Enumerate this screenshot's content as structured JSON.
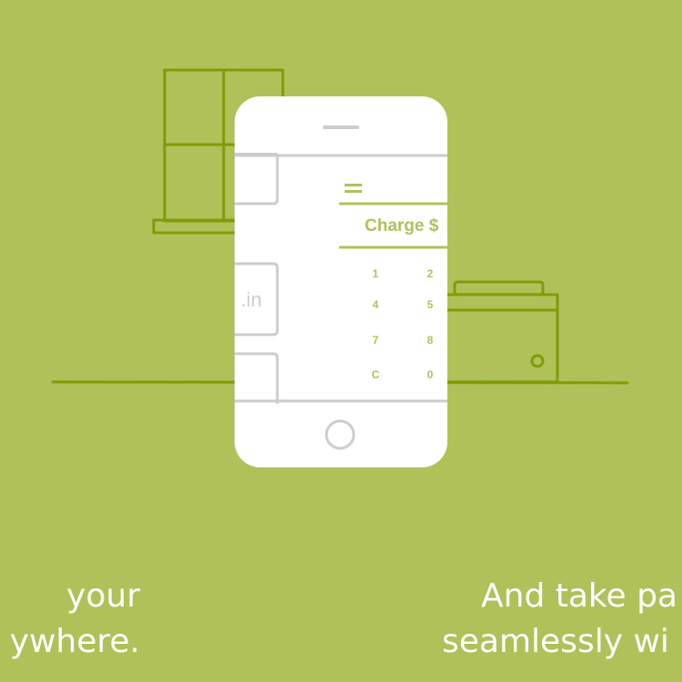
{
  "colors": {
    "background": "#b0c15a",
    "line_art": "#7e9c06",
    "phone_body": "#ffffff",
    "phone_outline": "#cccccc",
    "app_accent": "#b0c15a",
    "caption_text": "#ffffff"
  },
  "phone": {
    "app": {
      "menu_icon": "hamburger-menu-icon",
      "charge_label": "Charge $",
      "keypad_keys": [
        "1",
        "2",
        "4",
        "5",
        "7",
        "8",
        "C",
        "0"
      ],
      "left_panel_text": ".in"
    },
    "home_button_icon": "home-button-icon",
    "speaker_icon": "speaker-slot-icon"
  },
  "captions": {
    "left": {
      "line1": "your",
      "line2": "ywhere."
    },
    "right": {
      "line1": "And take pa",
      "line2": "seamlessly wi"
    }
  }
}
